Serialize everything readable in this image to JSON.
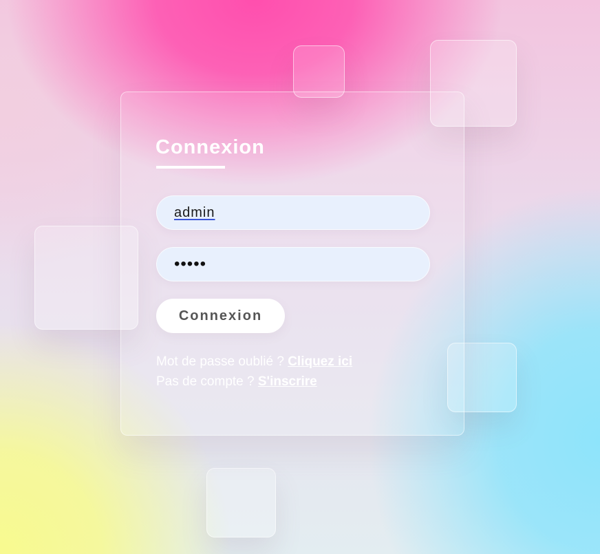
{
  "login": {
    "title": "Connexion",
    "username_value": "admin",
    "password_value": "•••••",
    "submit_label": "Connexion",
    "forgot_text": "Mot de passe oublié ? ",
    "forgot_link": "Cliquez ici",
    "signup_text": "Pas de compte ? ",
    "signup_link": "S'inscrire"
  },
  "colors": {
    "background_pink": "#ff4fae",
    "background_yellow": "#f8fa8f",
    "background_cyan": "#8ee4fb",
    "input_fill": "#e8f0fd",
    "button_fill": "#ffffff",
    "button_text": "#555555"
  }
}
